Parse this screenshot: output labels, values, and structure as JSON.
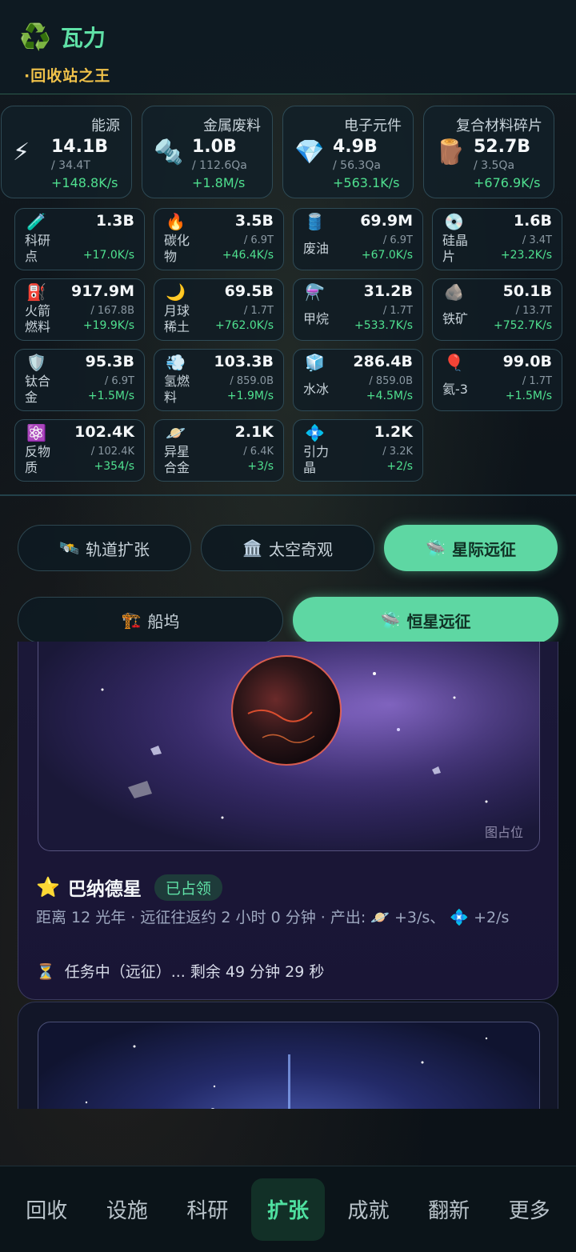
{
  "header": {
    "logo_icon": "♻️",
    "title": "瓦力",
    "subtitle": "·回收站之王"
  },
  "main_resources": [
    {
      "label": "能源",
      "icon": "⚡",
      "value": "14.1B",
      "cap": "/ 34.4T",
      "rate": "+148.8K/s"
    },
    {
      "label": "金属废料",
      "icon": "🔩",
      "value": "1.0B",
      "cap": "/ 112.6Qa",
      "rate": "+1.8M/s"
    },
    {
      "label": "电子元件",
      "icon": "💎",
      "value": "4.9B",
      "cap": "/ 56.3Qa",
      "rate": "+563.1K/s"
    },
    {
      "label": "复合材料碎片",
      "icon": "🪵",
      "value": "52.7B",
      "cap": "/ 3.5Qa",
      "rate": "+676.9K/s"
    }
  ],
  "resources": [
    {
      "label": "科研点",
      "icon": "🧪",
      "value": "1.3B",
      "cap": "",
      "rate": "+17.0K/s"
    },
    {
      "label": "碳化物",
      "icon": "🔥",
      "value": "3.5B",
      "cap": "/ 6.9T",
      "rate": "+46.4K/s"
    },
    {
      "label": "废油",
      "icon": "🛢️",
      "value": "69.9M",
      "cap": "/ 6.9T",
      "rate": "+67.0K/s"
    },
    {
      "label": "硅晶片",
      "icon": "💿",
      "value": "1.6B",
      "cap": "/ 3.4T",
      "rate": "+23.2K/s"
    },
    {
      "label": "火箭燃料",
      "icon": "⛽",
      "value": "917.9M",
      "cap": "/ 167.8B",
      "rate": "+19.9K/s"
    },
    {
      "label": "月球稀土",
      "icon": "🌙",
      "value": "69.5B",
      "cap": "/ 1.7T",
      "rate": "+762.0K/s"
    },
    {
      "label": "甲烷",
      "icon": "⚗️",
      "value": "31.2B",
      "cap": "/ 1.7T",
      "rate": "+533.7K/s"
    },
    {
      "label": "铁矿",
      "icon": "🪨",
      "value": "50.1B",
      "cap": "/ 13.7T",
      "rate": "+752.7K/s"
    },
    {
      "label": "钛合金",
      "icon": "🛡️",
      "value": "95.3B",
      "cap": "/ 6.9T",
      "rate": "+1.5M/s"
    },
    {
      "label": "氢燃料",
      "icon": "💨",
      "value": "103.3B",
      "cap": "/ 859.0B",
      "rate": "+1.9M/s"
    },
    {
      "label": "水冰",
      "icon": "🧊",
      "value": "286.4B",
      "cap": "/ 859.0B",
      "rate": "+4.5M/s"
    },
    {
      "label": "氦-3",
      "icon": "🎈",
      "value": "99.0B",
      "cap": "/ 1.7T",
      "rate": "+1.5M/s"
    },
    {
      "label": "反物质",
      "icon": "⚛️",
      "value": "102.4K",
      "cap": "/ 102.4K",
      "rate": "+354/s"
    },
    {
      "label": "异星合金",
      "icon": "🪐",
      "value": "2.1K",
      "cap": "/ 6.4K",
      "rate": "+3/s"
    },
    {
      "label": "引力晶",
      "icon": "💠",
      "value": "1.2K",
      "cap": "/ 3.2K",
      "rate": "+2/s"
    }
  ],
  "tabs_primary": [
    {
      "icon": "🛰️",
      "label": "轨道扩张",
      "active": false
    },
    {
      "icon": "🏛️",
      "label": "太空奇观",
      "active": false
    },
    {
      "icon": "🛸",
      "label": "星际远征",
      "active": true
    }
  ],
  "tabs_secondary": [
    {
      "icon": "🏗️",
      "label": "船坞",
      "active": false
    },
    {
      "icon": "🛸",
      "label": "恒星远征",
      "active": true
    }
  ],
  "card": {
    "image_placeholder": "图占位",
    "star_icon": "⭐",
    "name": "巴纳德星",
    "status": "已占领",
    "desc_prefix": "距离 12 光年 · 远征往返约 2 小时 0 分钟 · 产出:",
    "out1_icon": "🪐",
    "out1": "+3/s、",
    "out2_icon": "💠",
    "out2": "+2/s",
    "task_icon": "⏳",
    "task": "任务中（远征）... 剩余 49 分钟 29 秒"
  },
  "nav": [
    {
      "label": "回收",
      "active": false
    },
    {
      "label": "设施",
      "active": false
    },
    {
      "label": "科研",
      "active": false
    },
    {
      "label": "扩张",
      "active": true
    },
    {
      "label": "成就",
      "active": false
    },
    {
      "label": "翻新",
      "active": false
    },
    {
      "label": "更多",
      "active": false
    }
  ],
  "colors": {
    "accent": "#5ed7a3",
    "rate": "#4fe08f",
    "title_gold": "#f0c24a"
  }
}
